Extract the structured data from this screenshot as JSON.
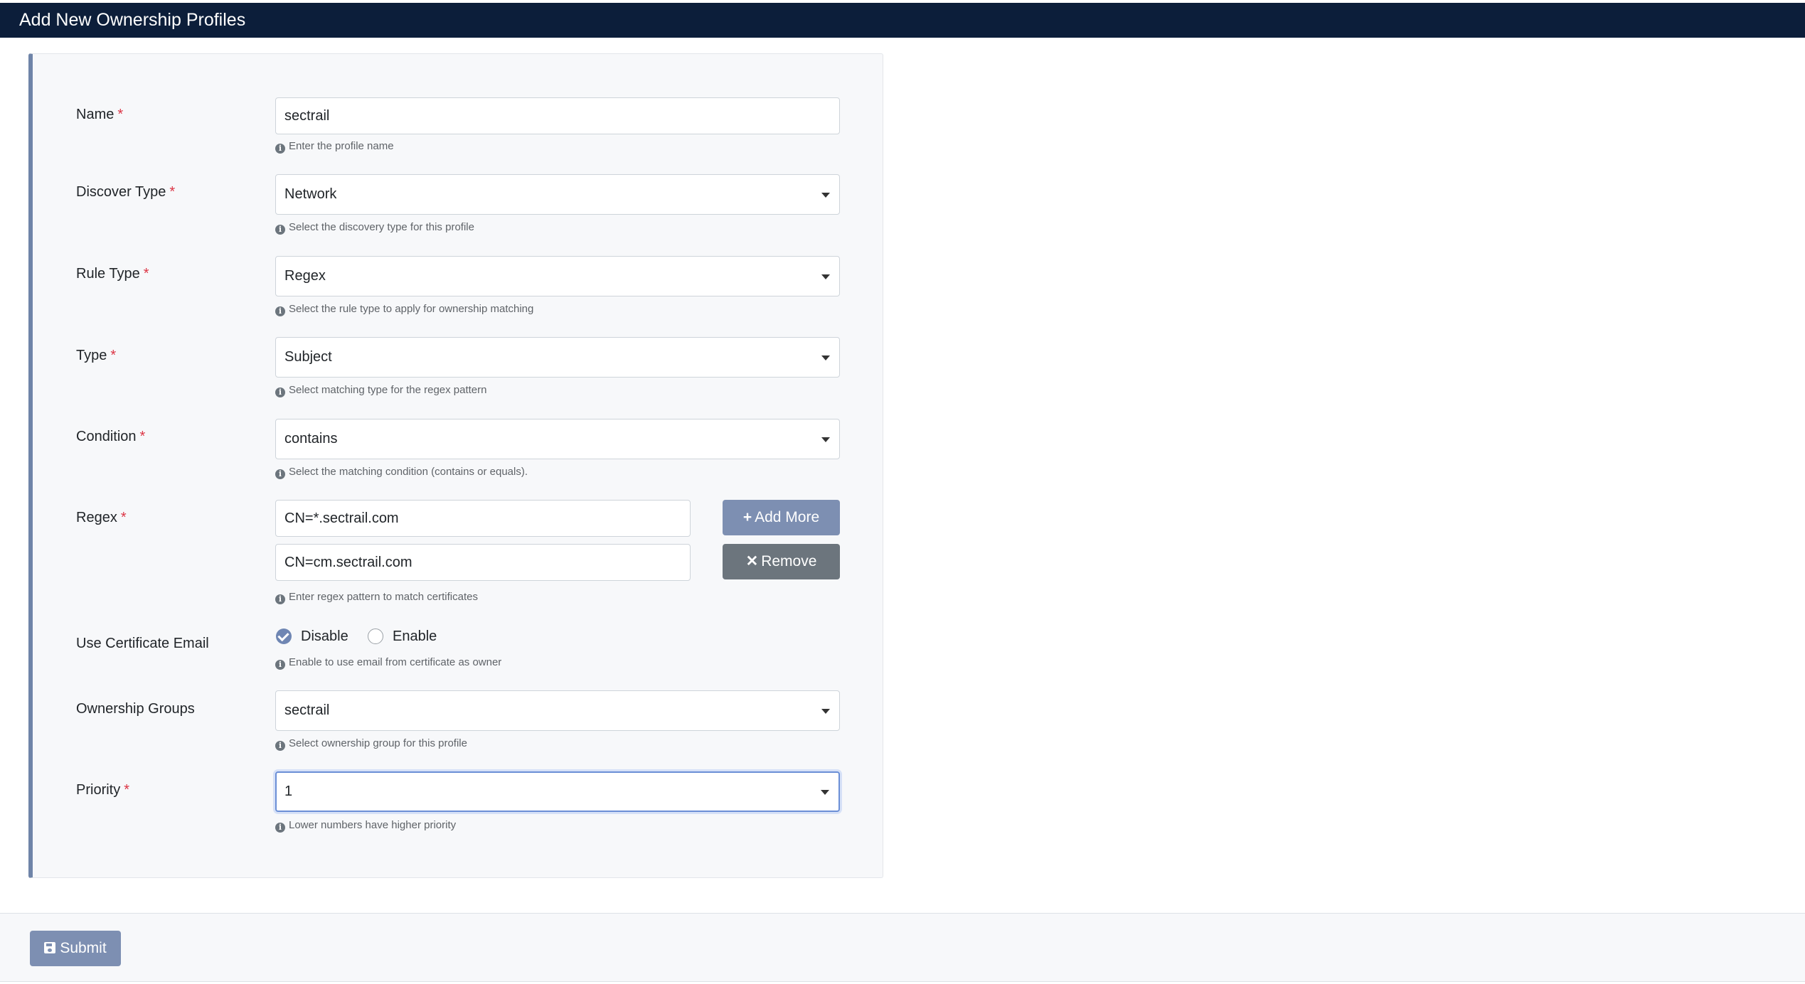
{
  "header": {
    "title": "Add New Ownership Profiles"
  },
  "form": {
    "required_mark": "*",
    "name": {
      "label": "Name",
      "value": "sectrail",
      "help": "Enter the profile name"
    },
    "discover_type": {
      "label": "Discover Type",
      "value": "Network",
      "help": "Select the discovery type for this profile"
    },
    "rule_type": {
      "label": "Rule Type",
      "value": "Regex",
      "help": "Select the rule type to apply for ownership matching"
    },
    "type": {
      "label": "Type",
      "value": "Subject",
      "help": "Select matching type for the regex pattern"
    },
    "condition": {
      "label": "Condition",
      "value": "contains",
      "help": "Select the matching condition (contains or equals)."
    },
    "regex": {
      "label": "Regex",
      "values": [
        "CN=*.sectrail.com",
        "CN=cm.sectrail.com"
      ],
      "add_more_label": "Add More",
      "remove_label": "Remove",
      "help": "Enter regex pattern to match certificates"
    },
    "use_cert_email": {
      "label": "Use Certificate Email",
      "options": [
        "Disable",
        "Enable"
      ],
      "selected": "Disable",
      "help": "Enable to use email from certificate as owner"
    },
    "ownership_groups": {
      "label": "Ownership Groups",
      "value": "sectrail",
      "help": "Select ownership group for this profile"
    },
    "priority": {
      "label": "Priority",
      "value": "1",
      "help": "Lower numbers have higher priority"
    }
  },
  "footer": {
    "submit_label": "Submit"
  },
  "colors": {
    "header_bg": "#0c1e3a",
    "accent": "#7d8fb2",
    "required": "#dc3545"
  },
  "icons": {
    "info": "info-circle-icon",
    "add": "plus-icon",
    "remove": "x-icon",
    "submit": "floppy-disk-icon",
    "dropdown": "caret-down-icon"
  }
}
